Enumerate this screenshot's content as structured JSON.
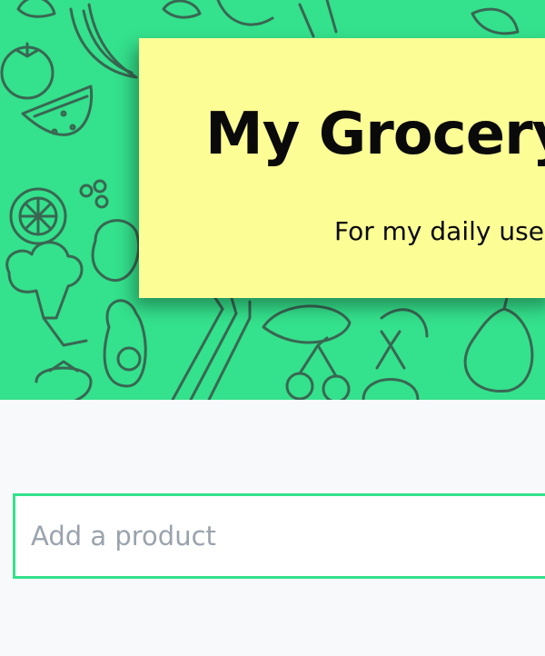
{
  "colors": {
    "hero_background": "#34e18c",
    "doodle_stroke": "#3a5a4c",
    "card_background": "#fdfd96",
    "page_background": "#f8f9fb",
    "input_border": "#34e18c"
  },
  "hero": {
    "pattern": "vegetable-and-fruit-doodle-pattern",
    "title": "My Grocery",
    "subtitle": "For my daily use"
  },
  "add_product": {
    "value": "",
    "placeholder": "Add a product"
  }
}
